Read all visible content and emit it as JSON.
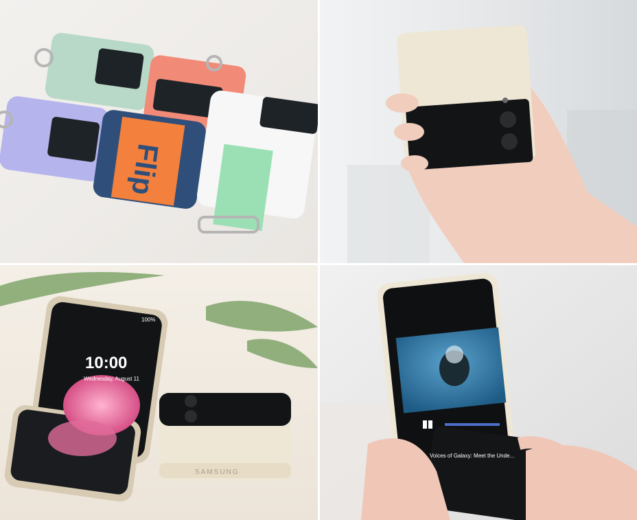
{
  "photos": [
    {
      "id": "cases",
      "strap_text": "Flip"
    },
    {
      "id": "hand-held",
      "strap_text": ""
    },
    {
      "id": "open-phone",
      "status_bar": "100%",
      "lock_time": "10:00",
      "lock_date": "Wednesday, August 11",
      "brand": "SAMSUNG"
    },
    {
      "id": "video",
      "video_title": "Voices of Galaxy: Meet the Unde..."
    }
  ],
  "colors": {
    "mint": "#b8d9c8",
    "coral": "#f18a76",
    "lavender": "#b6b4ec",
    "navy": "#2f4f7a",
    "orange": "#f3803d",
    "white_case": "#f6f7f6",
    "cream": "#efe7d5",
    "phone_dark": "#121416",
    "underwater": "#2f7aa8"
  }
}
